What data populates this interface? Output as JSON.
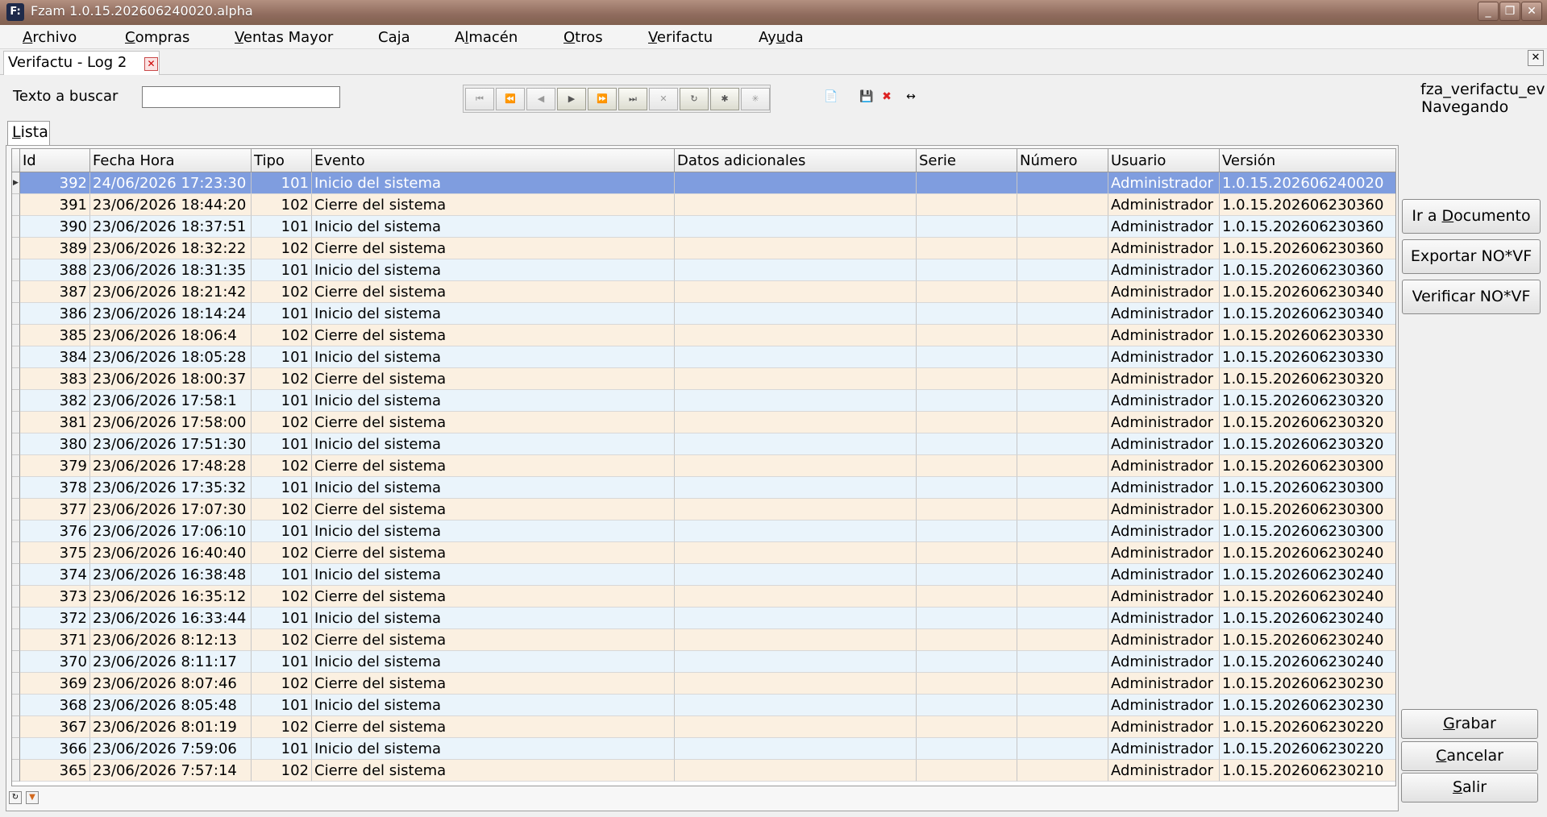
{
  "window": {
    "title": "Fzam 1.0.15.202606240020.alpha",
    "app_icon": "F:"
  },
  "menu": [
    "Archivo",
    "Compras",
    "Ventas Mayor",
    "Caja",
    "Almacén",
    "Otros",
    "Verifactu",
    "Ayuda"
  ],
  "doc_tab": {
    "label": "Verifactu - Log 2",
    "close_glyph": "✕"
  },
  "search": {
    "label": "Texto a buscar",
    "value": ""
  },
  "status": {
    "name": "fza_verifactu_ev",
    "mode": "Navegando"
  },
  "subtab": {
    "label": "Lista"
  },
  "grid": {
    "columns": [
      "Id",
      "Fecha Hora",
      "Tipo",
      "Evento",
      "Datos adicionales",
      "Serie",
      "Número",
      "Usuario",
      "Versión"
    ],
    "rows": [
      [
        "392",
        "24/06/2026 17:23:30",
        "101",
        "Inicio del sistema",
        "",
        "",
        "",
        "Administrador",
        "1.0.15.202606240020"
      ],
      [
        "391",
        "23/06/2026 18:44:20",
        "102",
        "Cierre del sistema",
        "",
        "",
        "",
        "Administrador",
        "1.0.15.202606230360"
      ],
      [
        "390",
        "23/06/2026 18:37:51",
        "101",
        "Inicio del sistema",
        "",
        "",
        "",
        "Administrador",
        "1.0.15.202606230360"
      ],
      [
        "389",
        "23/06/2026 18:32:22",
        "102",
        "Cierre del sistema",
        "",
        "",
        "",
        "Administrador",
        "1.0.15.202606230360"
      ],
      [
        "388",
        "23/06/2026 18:31:35",
        "101",
        "Inicio del sistema",
        "",
        "",
        "",
        "Administrador",
        "1.0.15.202606230360"
      ],
      [
        "387",
        "23/06/2026 18:21:42",
        "102",
        "Cierre del sistema",
        "",
        "",
        "",
        "Administrador",
        "1.0.15.202606230340"
      ],
      [
        "386",
        "23/06/2026 18:14:24",
        "101",
        "Inicio del sistema",
        "",
        "",
        "",
        "Administrador",
        "1.0.15.202606230340"
      ],
      [
        "385",
        "23/06/2026 18:06:4",
        "102",
        "Cierre del sistema",
        "",
        "",
        "",
        "Administrador",
        "1.0.15.202606230330"
      ],
      [
        "384",
        "23/06/2026 18:05:28",
        "101",
        "Inicio del sistema",
        "",
        "",
        "",
        "Administrador",
        "1.0.15.202606230330"
      ],
      [
        "383",
        "23/06/2026 18:00:37",
        "102",
        "Cierre del sistema",
        "",
        "",
        "",
        "Administrador",
        "1.0.15.202606230320"
      ],
      [
        "382",
        "23/06/2026 17:58:1",
        "101",
        "Inicio del sistema",
        "",
        "",
        "",
        "Administrador",
        "1.0.15.202606230320"
      ],
      [
        "381",
        "23/06/2026 17:58:00",
        "102",
        "Cierre del sistema",
        "",
        "",
        "",
        "Administrador",
        "1.0.15.202606230320"
      ],
      [
        "380",
        "23/06/2026 17:51:30",
        "101",
        "Inicio del sistema",
        "",
        "",
        "",
        "Administrador",
        "1.0.15.202606230320"
      ],
      [
        "379",
        "23/06/2026 17:48:28",
        "102",
        "Cierre del sistema",
        "",
        "",
        "",
        "Administrador",
        "1.0.15.202606230300"
      ],
      [
        "378",
        "23/06/2026 17:35:32",
        "101",
        "Inicio del sistema",
        "",
        "",
        "",
        "Administrador",
        "1.0.15.202606230300"
      ],
      [
        "377",
        "23/06/2026 17:07:30",
        "102",
        "Cierre del sistema",
        "",
        "",
        "",
        "Administrador",
        "1.0.15.202606230300"
      ],
      [
        "376",
        "23/06/2026 17:06:10",
        "101",
        "Inicio del sistema",
        "",
        "",
        "",
        "Administrador",
        "1.0.15.202606230300"
      ],
      [
        "375",
        "23/06/2026 16:40:40",
        "102",
        "Cierre del sistema",
        "",
        "",
        "",
        "Administrador",
        "1.0.15.202606230240"
      ],
      [
        "374",
        "23/06/2026 16:38:48",
        "101",
        "Inicio del sistema",
        "",
        "",
        "",
        "Administrador",
        "1.0.15.202606230240"
      ],
      [
        "373",
        "23/06/2026 16:35:12",
        "102",
        "Cierre del sistema",
        "",
        "",
        "",
        "Administrador",
        "1.0.15.202606230240"
      ],
      [
        "372",
        "23/06/2026 16:33:44",
        "101",
        "Inicio del sistema",
        "",
        "",
        "",
        "Administrador",
        "1.0.15.202606230240"
      ],
      [
        "371",
        "23/06/2026 8:12:13",
        "102",
        "Cierre del sistema",
        "",
        "",
        "",
        "Administrador",
        "1.0.15.202606230240"
      ],
      [
        "370",
        "23/06/2026 8:11:17",
        "101",
        "Inicio del sistema",
        "",
        "",
        "",
        "Administrador",
        "1.0.15.202606230240"
      ],
      [
        "369",
        "23/06/2026 8:07:46",
        "102",
        "Cierre del sistema",
        "",
        "",
        "",
        "Administrador",
        "1.0.15.202606230230"
      ],
      [
        "368",
        "23/06/2026 8:05:48",
        "101",
        "Inicio del sistema",
        "",
        "",
        "",
        "Administrador",
        "1.0.15.202606230230"
      ],
      [
        "367",
        "23/06/2026 8:01:19",
        "102",
        "Cierre del sistema",
        "",
        "",
        "",
        "Administrador",
        "1.0.15.202606230220"
      ],
      [
        "366",
        "23/06/2026 7:59:06",
        "101",
        "Inicio del sistema",
        "",
        "",
        "",
        "Administrador",
        "1.0.15.202606230220"
      ],
      [
        "365",
        "23/06/2026 7:57:14",
        "102",
        "Cierre del sistema",
        "",
        "",
        "",
        "Administrador",
        "1.0.15.202606230210"
      ]
    ],
    "selected_index": 0
  },
  "side_buttons": [
    {
      "pre": "Ir a ",
      "u": "D",
      "post": "ocumento"
    },
    {
      "pre": "Exportar NO*VF",
      "u": "",
      "post": ""
    },
    {
      "pre": "Verificar NO*VF",
      "u": "",
      "post": ""
    }
  ],
  "bottom_buttons": [
    {
      "pre": "",
      "u": "G",
      "post": "rabar"
    },
    {
      "pre": "",
      "u": "C",
      "post": "ancelar"
    },
    {
      "pre": "",
      "u": "S",
      "post": "alir"
    }
  ],
  "colors": {
    "selected_row": "#7f9ddf",
    "odd_row": "#eaf4fb",
    "even_row": "#fbf0e1",
    "titlebar": "#8f6b5d"
  }
}
